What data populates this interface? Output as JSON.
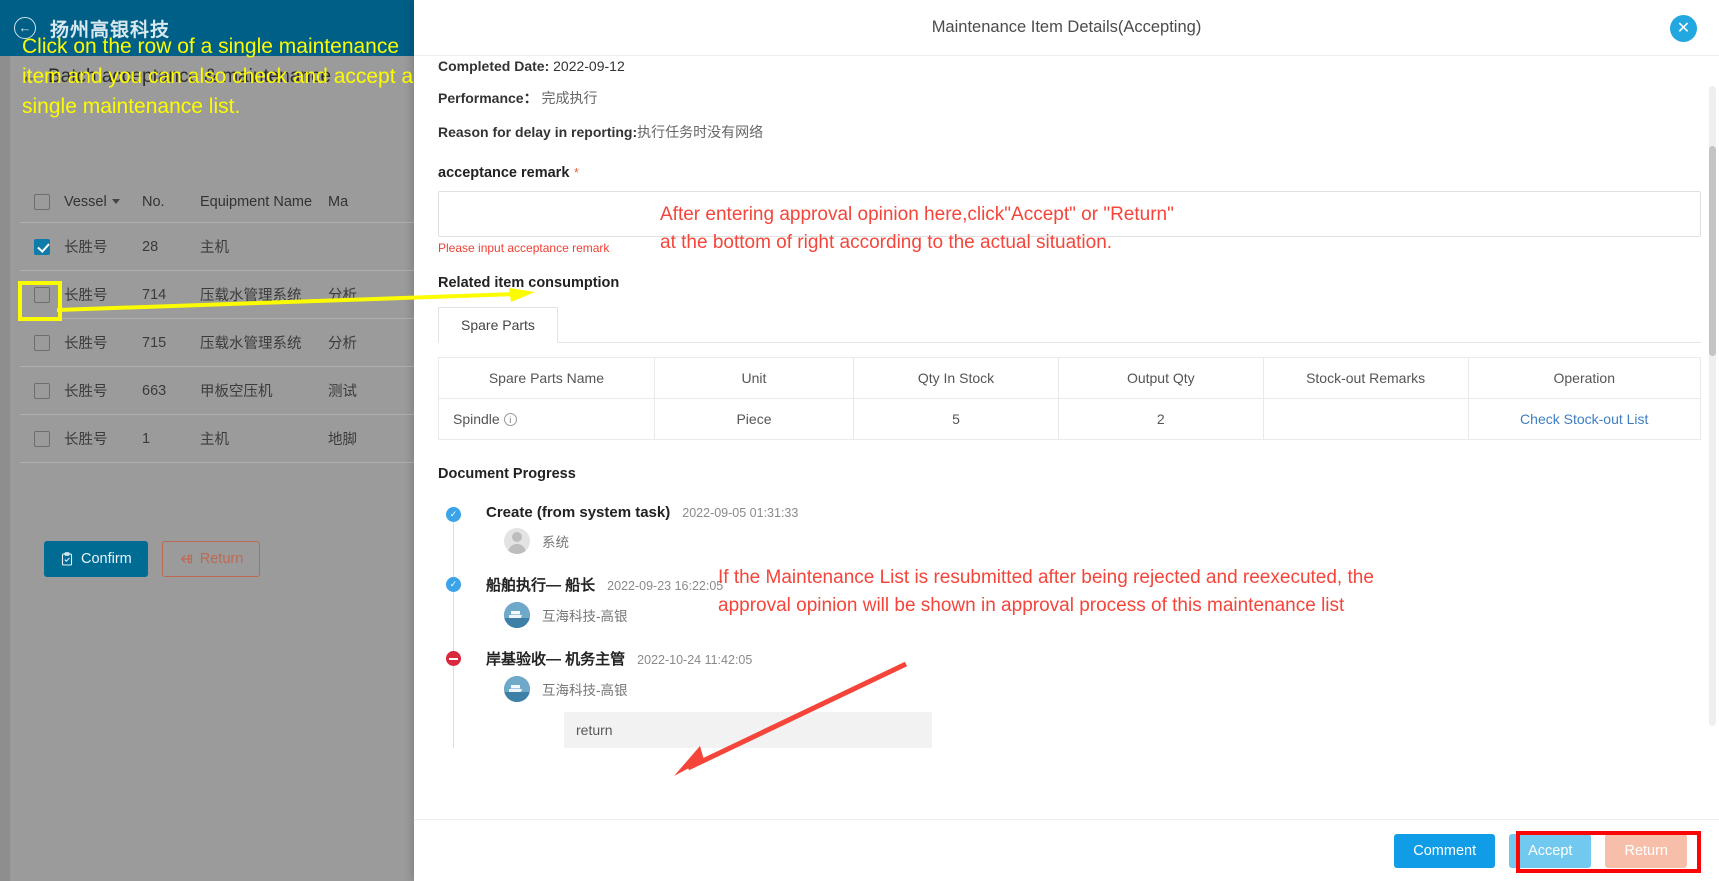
{
  "background_app": {
    "topbar": {
      "brand": "扬州高银科技",
      "back_icon": "back-circle-icon"
    },
    "page_title": "Batch acceptance & maintenance",
    "annotation_yellow": "Click on the row of a single maintenance item and you can also check and accept a single maintenance list.",
    "table": {
      "columns": [
        "",
        "Vessel",
        "No.",
        "Equipment Name",
        "Ma"
      ],
      "rows": [
        {
          "checked": true,
          "vessel": "长胜号",
          "no": "28",
          "equipment": "主机",
          "ma": ""
        },
        {
          "checked": false,
          "vessel": "长胜号",
          "no": "714",
          "equipment": "压载水管理系统",
          "ma": "分析"
        },
        {
          "checked": false,
          "vessel": "长胜号",
          "no": "715",
          "equipment": "压载水管理系统",
          "ma": "分析"
        },
        {
          "checked": false,
          "vessel": "长胜号",
          "no": "663",
          "equipment": "甲板空压机",
          "ma": "测试"
        },
        {
          "checked": false,
          "vessel": "长胜号",
          "no": "1",
          "equipment": "主机",
          "ma": "地脚"
        }
      ]
    },
    "buttons": {
      "confirm": "Confirm",
      "return": "Return"
    }
  },
  "modal": {
    "title": "Maintenance Item Details(Accepting)",
    "close_icon": "close-icon",
    "fields": {
      "completed_date_label": "Completed Date:",
      "completed_date_value": "2022-09-12",
      "performance_label": "Performance：",
      "performance_value": "完成执行",
      "delay_label": "Reason for delay in reporting:",
      "delay_value": "执行任务时没有网络"
    },
    "acceptance_remark": {
      "label": "acceptance remark",
      "required_mark": "*",
      "value": "",
      "placeholder": "",
      "error": "Please input acceptance remark"
    },
    "annotation_red_1": "After entering approval opinion here,click\"Accept\" or \"Return\"\nat the bottom of right according to the actual situation.",
    "related_item_consumption": "Related item consumption",
    "tabs": [
      {
        "label": "Spare Parts",
        "active": true
      }
    ],
    "spare_parts_table": {
      "columns": [
        "Spare Parts Name",
        "Unit",
        "Qty In Stock",
        "Output Qty",
        "Stock-out Remarks",
        "Operation"
      ],
      "rows": [
        {
          "name": "Spindle",
          "info_icon": "info-circle-icon",
          "unit": "Piece",
          "qty_in_stock": "5",
          "output_qty": "2",
          "stock_out_remarks": "",
          "operation": "Check Stock-out List"
        }
      ]
    },
    "document_progress": {
      "title": "Document Progress",
      "nodes": [
        {
          "status": "done",
          "title": "Create (from system task)",
          "time": "2022-09-05 01:31:33",
          "user": "系统",
          "avatar": "person-avatar",
          "comment": ""
        },
        {
          "status": "done",
          "title": "船舶执行— 船长",
          "time": "2022-09-23 16:22:05",
          "user": "互海科技-高银",
          "avatar": "ship-avatar",
          "comment": ""
        },
        {
          "status": "rejected",
          "title": "岸基验收— 机务主管",
          "time": "2022-10-24 11:42:05",
          "user": "互海科技-高银",
          "avatar": "ship-avatar",
          "comment": "return"
        }
      ]
    },
    "annotation_red_2": "If the Maintenance List is resubmitted after being rejected and reexecuted, the\napproval opinion will be shown in approval process of this maintenance list",
    "footer_buttons": {
      "comment": "Comment",
      "accept": "Accept",
      "return": "Return"
    }
  },
  "colors": {
    "brand_blue": "#005f87",
    "accent_blue": "#119ce8",
    "accept_blue": "#72c9f0",
    "return_peach": "#f7bfaa",
    "annotation_yellow": "#fcfc00",
    "annotation_red": "#f5453a",
    "highlight_red": "#fb0606",
    "error_red": "#f04134",
    "link_blue": "#3e7ec1"
  }
}
